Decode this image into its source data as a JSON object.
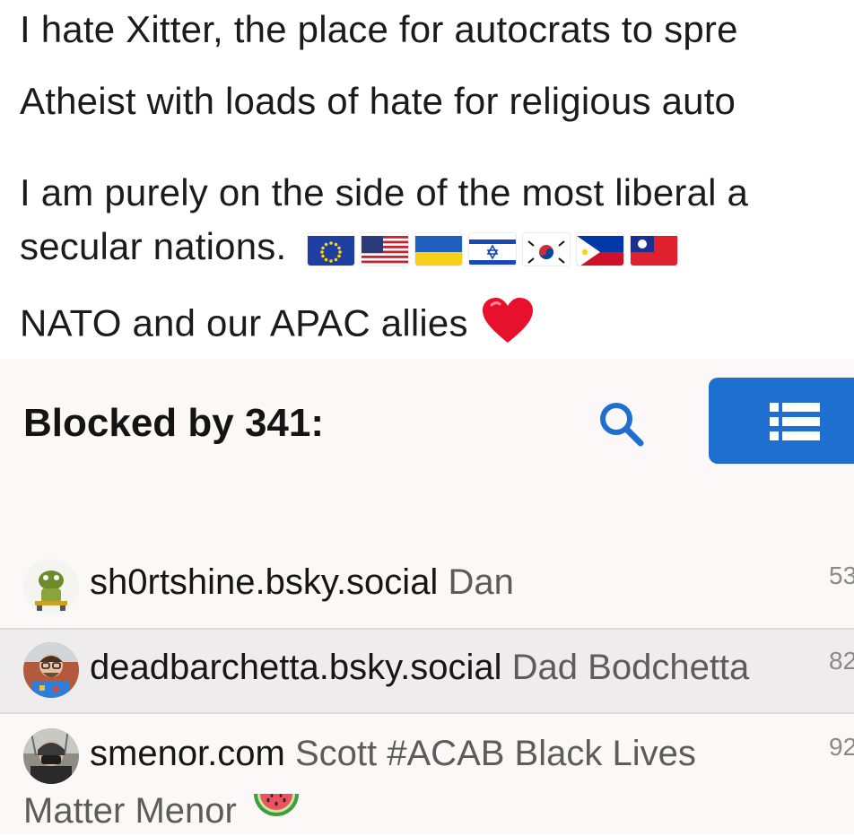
{
  "bio": {
    "line1": "I hate Xitter, the place for autocrats to spre",
    "line2": "Atheist with loads of hate for religious auto",
    "line3": "I am purely on the side of the most liberal a",
    "line4_text": "secular nations.",
    "flags": [
      "eu-flag-icon",
      "us-flag-icon",
      "ukraine-flag-icon",
      "israel-flag-icon",
      "south-korea-flag-icon",
      "philippines-flag-icon",
      "taiwan-flag-icon"
    ],
    "line5": "NATO and our APAC allies",
    "heart_icon": "red-heart-icon"
  },
  "blocked": {
    "title": "Blocked by 341:",
    "search_icon": "search-icon",
    "list_icon": "list-icon",
    "accent_color": "#1f6fd0"
  },
  "rows": [
    {
      "handle": "sh0rtshine.bsky.social",
      "display_name": "Dan",
      "count": "53"
    },
    {
      "handle": "deadbarchetta.bsky.social",
      "display_name": "Dad Bodchetta",
      "count": "82"
    },
    {
      "handle": "smenor.com",
      "display_name": "Scott #ACAB Black Lives",
      "display_name_cont": "Matter Menor",
      "count": "92",
      "trailing_icon": "watermelon-icon"
    }
  ]
}
